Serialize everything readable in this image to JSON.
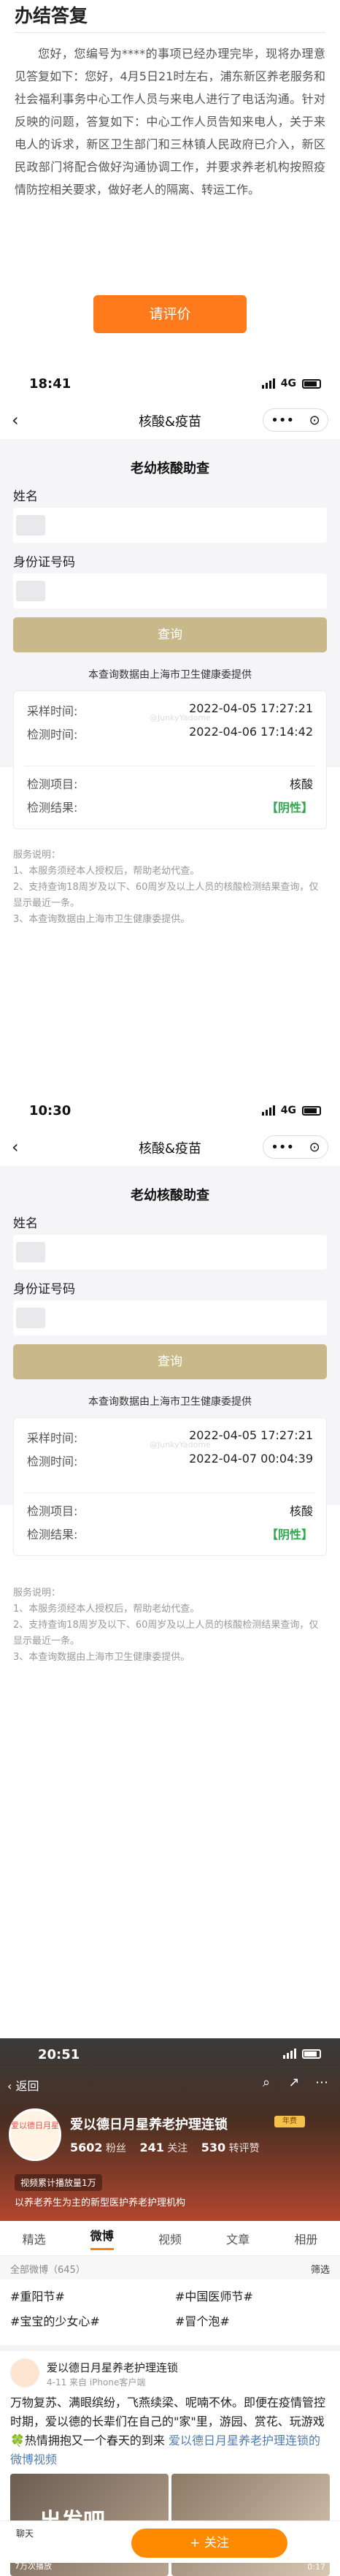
{
  "reply": {
    "title": "办结答复",
    "body": "您好，您编号为****的事项已经办理完毕，现将办理意见答复如下：您好，4月5日21时左右，浦东新区养老服务和社会福利事务中心工作人员与来电人进行了电话沟通。针对反映的问题，答复如下：中心工作人员告知来电人，关于来电人的诉求，新区卫生部门和三林镇人民政府已介入，新区民政部门将配合做好沟通协调工作，并要求养老机构按照疫情防控相关要求，做好老人的隔离、转运工作。",
    "rate_button": "请评价"
  },
  "screens": [
    {
      "time": "18:41",
      "network": "4G",
      "nav_back": "‹",
      "nav_title": "核酸&疫苗",
      "capsule": [
        "•••",
        "⊙"
      ],
      "subtitle": "老幼核酸助查",
      "name_label": "姓名",
      "id_label": "身份证号码",
      "query_button": "查询",
      "source_note": "本查询数据由上海市卫生健康委提供",
      "result": [
        {
          "k": "采样时间:",
          "v": "2022-04-05 17:27:21"
        },
        {
          "k": "检测时间:",
          "v": "2022-04-06 17:14:42"
        },
        {
          "k": "检测项目:",
          "v": "核酸"
        },
        {
          "k": "检测结果:",
          "v": "【阴性】"
        }
      ],
      "watermark": "@JunkyYadome",
      "explain": [
        "服务说明：",
        "1、本服务须经本人授权后，帮助老幼代查。",
        "2、支持查询18周岁及以下、60周岁及以上人员的核酸检测结果查询，仅显示最近一条。",
        "3、本查询数据由上海市卫生健康委提供。"
      ]
    },
    {
      "time": "10:30",
      "network": "4G",
      "nav_back": "‹",
      "nav_title": "核酸&疫苗",
      "capsule": [
        "•••",
        "⊙"
      ],
      "subtitle": "老幼核酸助查",
      "name_label": "姓名",
      "id_label": "身份证号码",
      "query_button": "查询",
      "source_note": "本查询数据由上海市卫生健康委提供",
      "result": [
        {
          "k": "采样时间:",
          "v": "2022-04-05 17:27:21"
        },
        {
          "k": "检测时间:",
          "v": "2022-04-07 00:04:39"
        },
        {
          "k": "检测项目:",
          "v": "核酸"
        },
        {
          "k": "检测结果:",
          "v": "【阴性】"
        }
      ],
      "watermark": "@JunkyYadome",
      "explain": [
        "服务说明：",
        "1、本服务须经本人授权后，帮助老幼代查。",
        "2、支持查询18周岁及以下、60周岁及以上人员的核酸检测结果查询，仅显示最近一条。",
        "3、本查询数据由上海市卫生健康委提供。"
      ]
    }
  ],
  "weibo": {
    "time": "20:51",
    "back": "‹ 返回",
    "avatar_text": "爱以德日月星",
    "name": "爱以德日月星养老护理连锁",
    "vip": "年费",
    "stats": {
      "followers": "5602",
      "followers_label": "粉丝",
      "following": "241",
      "following_label": "关注",
      "likes": "530",
      "likes_label": "转评赞"
    },
    "tag": "视频累计播放量1万",
    "cert": "以养老养生为主的新型医护养老护理机构",
    "tabs": [
      "精选",
      "微博",
      "视频",
      "文章",
      "相册"
    ],
    "filter_left": "全部微博（645）",
    "filter_right": "筛选",
    "topics": [
      "#重阳节#",
      "#中国医师节#",
      "#宝宝的少女心#",
      "#冒个泡#"
    ],
    "post": {
      "name": "爱以德日月星养老护理连锁",
      "meta": "4-11 来自 iPhone客户端",
      "text": "万物复苏、满眼缤纷，飞燕续梁、呢喃不休。即便在疫情管控时期，爱以德的长辈们在自己的\"家\"里，游园、赏花、玩游戏🍀热情拥抱又一个春天的到来",
      "link": "爱以德日月星养老护理连锁的微博视频",
      "img_caption": "出发吧",
      "img_count": "7万次播放",
      "img_duration": "0:17"
    },
    "bottom_msg": "聊天",
    "follow_button": "+ 关注"
  }
}
